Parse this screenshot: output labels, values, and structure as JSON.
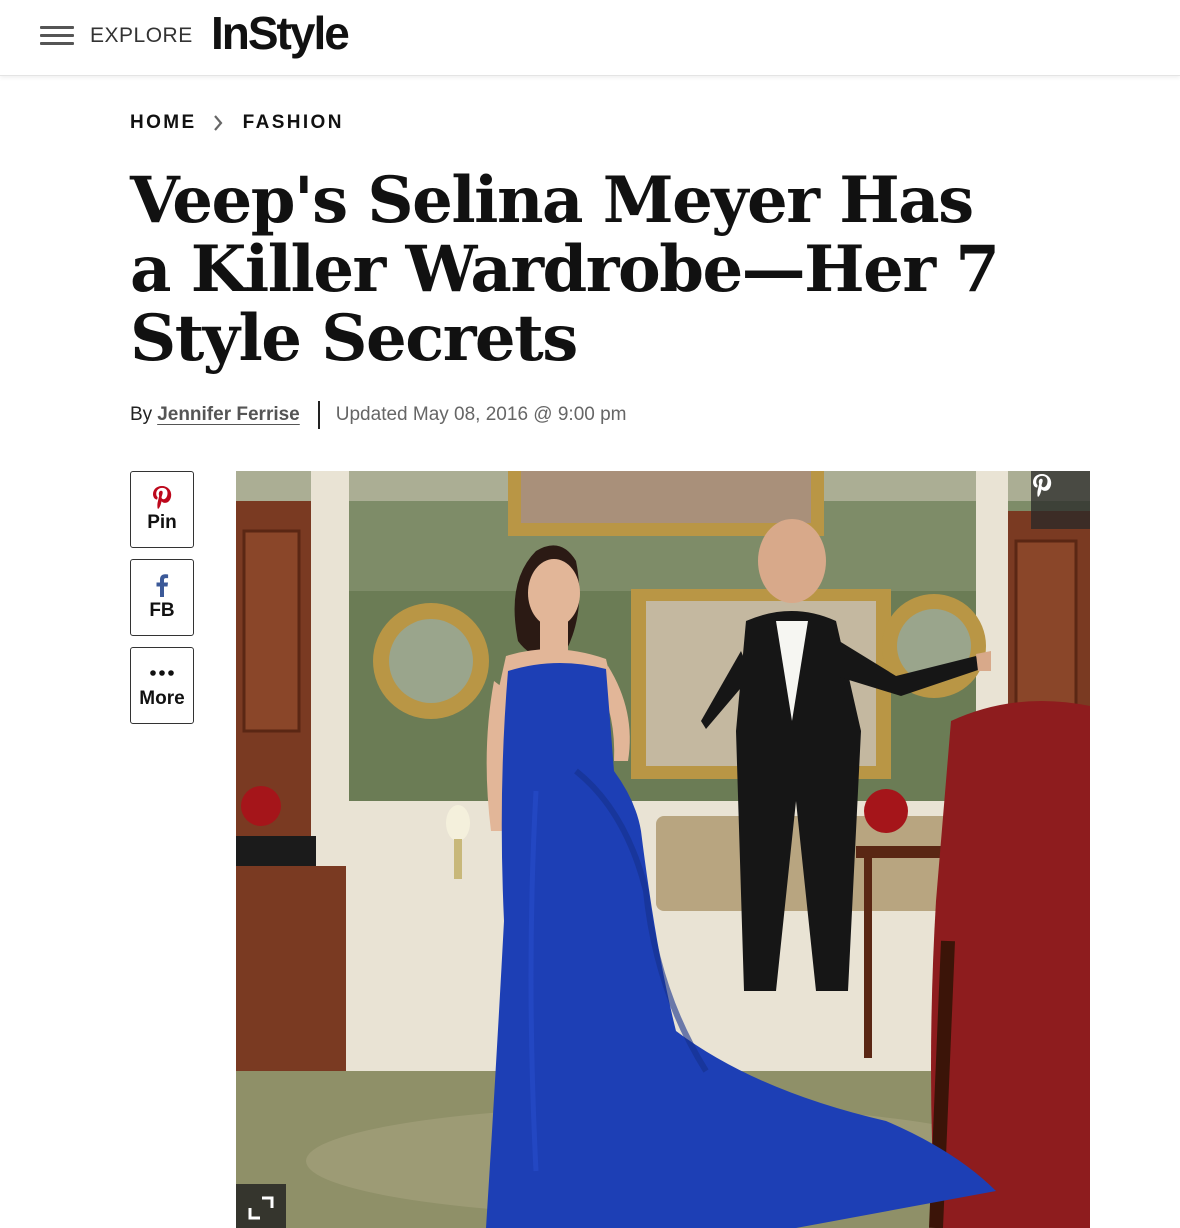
{
  "header": {
    "menu_label": "EXPLORE",
    "logo": "InStyle"
  },
  "breadcrumb": {
    "items": [
      "HOME",
      "FASHION"
    ]
  },
  "article": {
    "title": "Veep's Selina Meyer Has a Killer Wardrobe—Her 7 Style Secrets",
    "byline_prefix": "By",
    "author": "Jennifer Ferrise",
    "updated": "Updated May 08, 2016 @ 9:00 pm"
  },
  "share": {
    "pin_label": "Pin",
    "fb_label": "FB",
    "more_label": "More"
  },
  "colors": {
    "pinterest": "#bd081c",
    "facebook": "#3b5998",
    "dress": "#1d3fb5",
    "wall": "#6b7c55"
  }
}
